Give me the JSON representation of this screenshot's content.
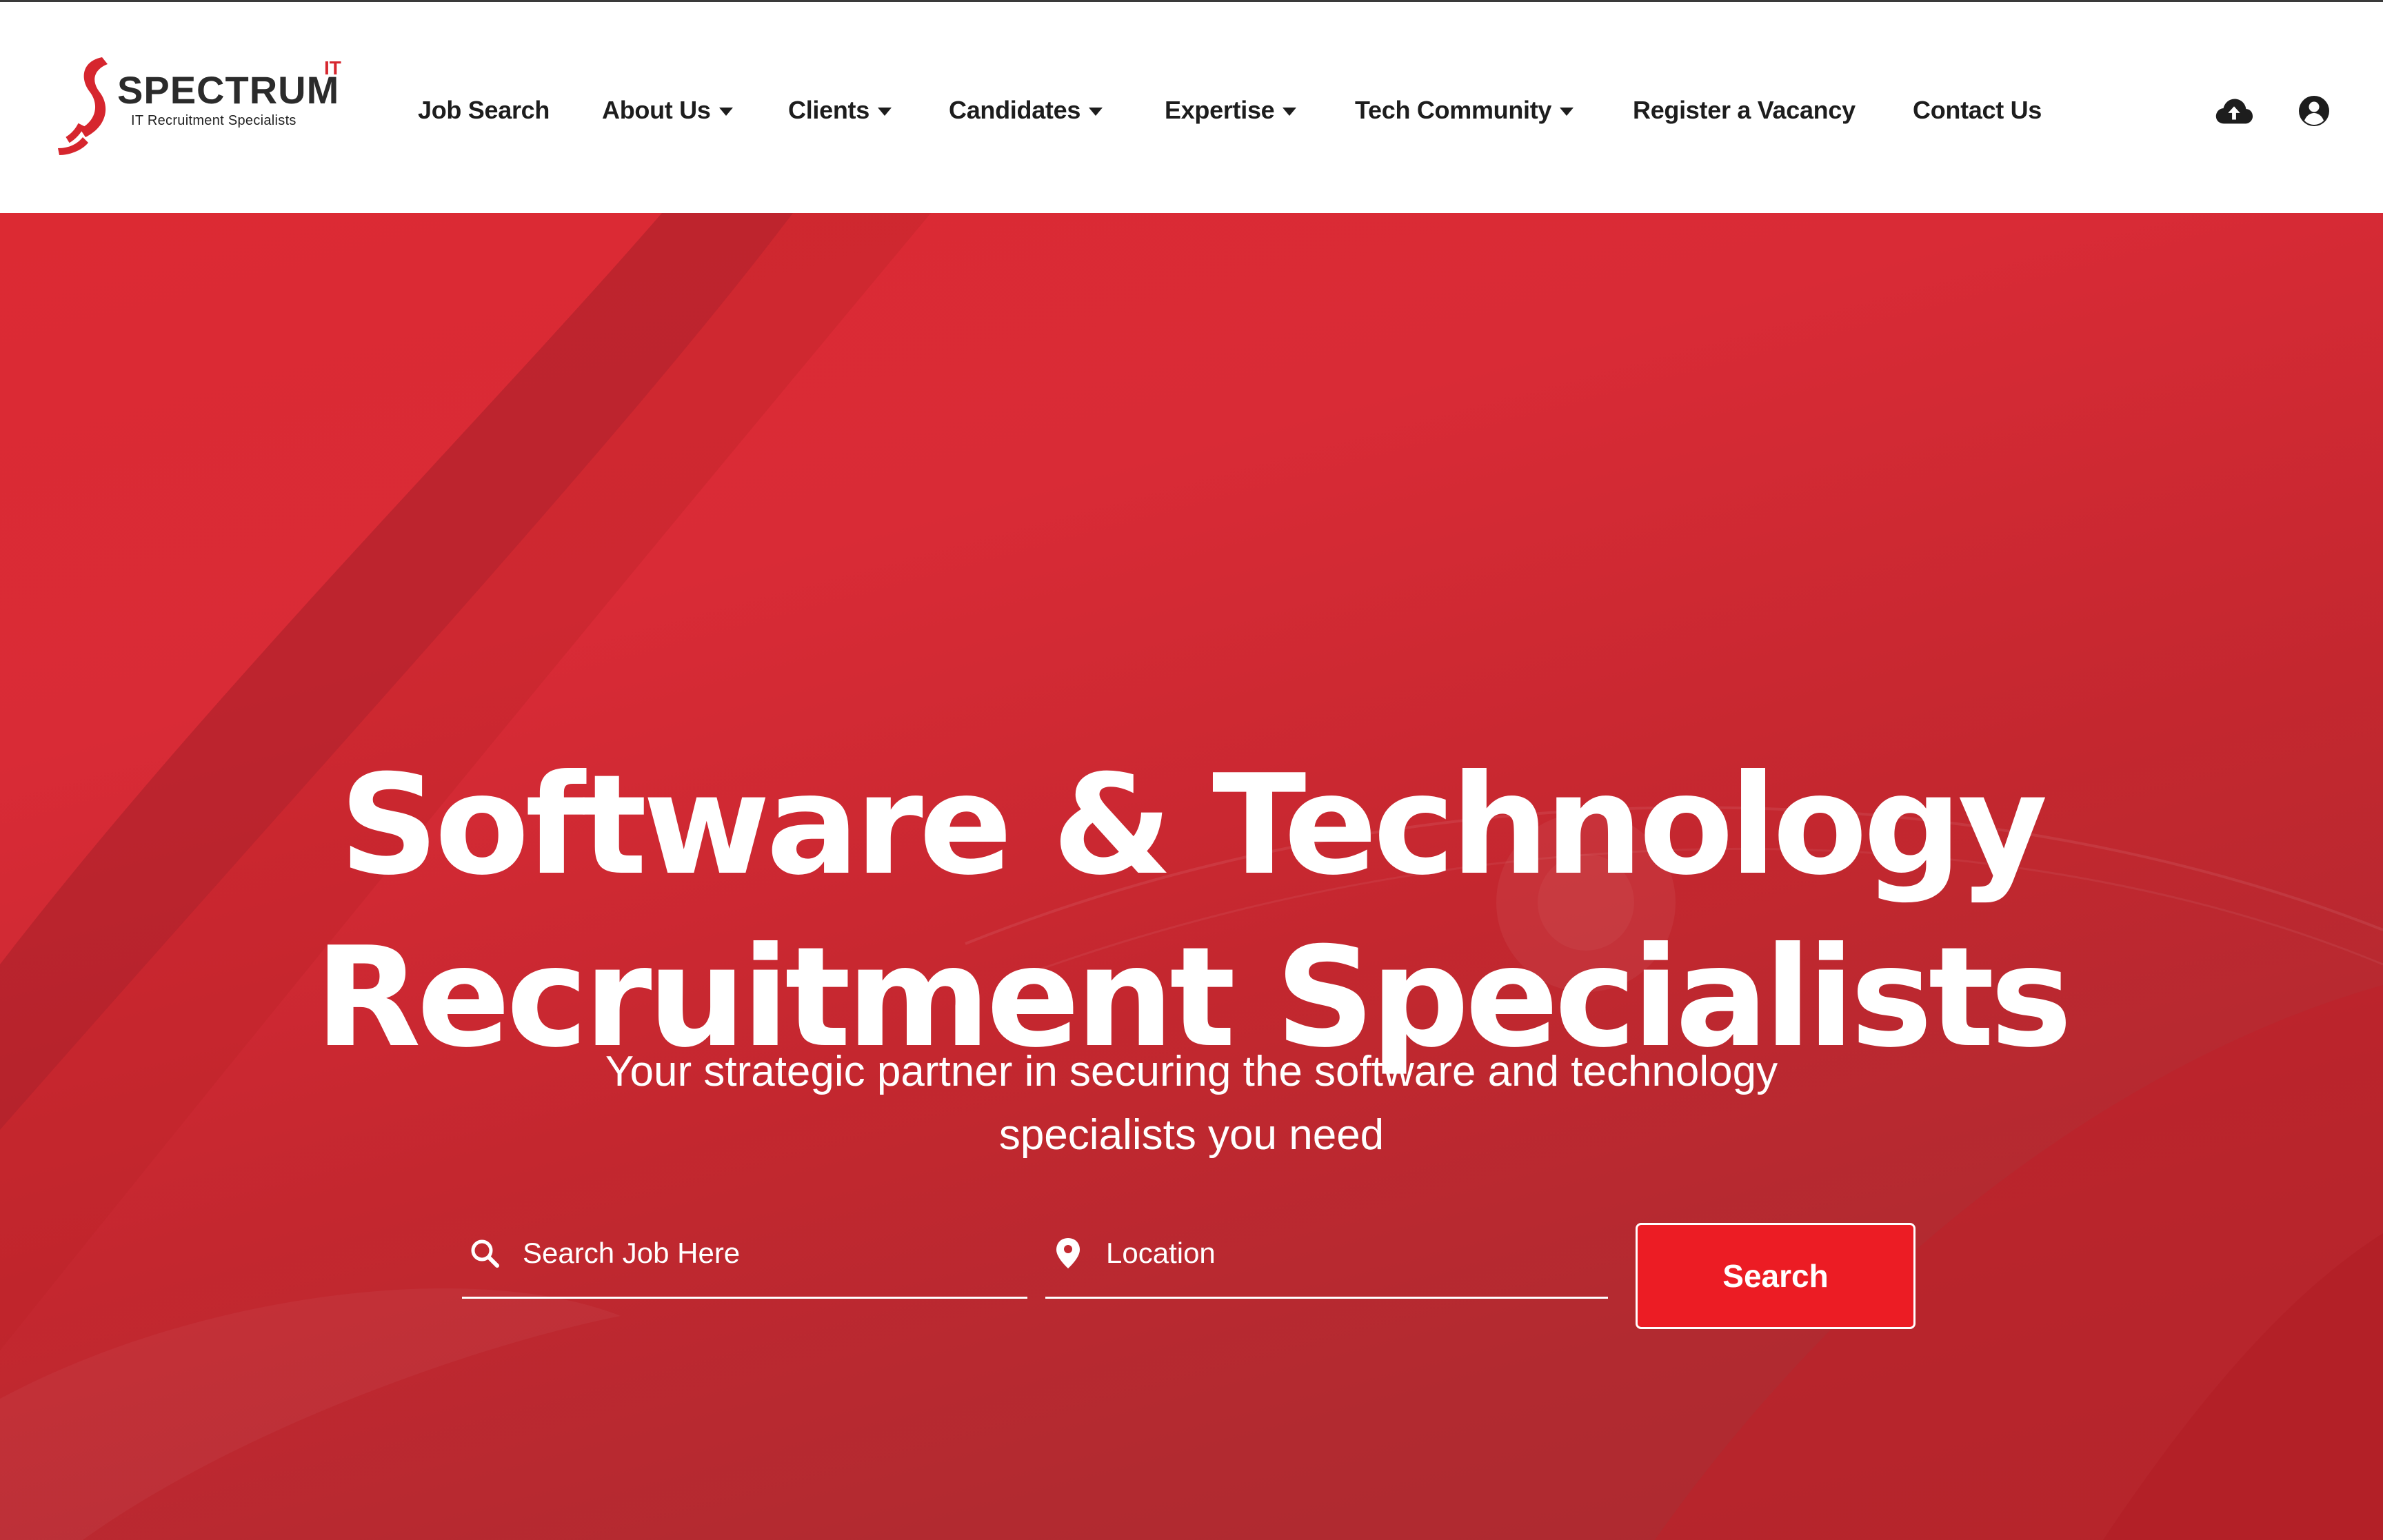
{
  "brand": {
    "name": "SPECTRUM",
    "superscript": "IT",
    "tagline": "IT Recruitment Specialists",
    "primary_color": "#d6262e"
  },
  "nav": {
    "items": [
      {
        "label": "Job Search",
        "has_dropdown": false
      },
      {
        "label": "About Us",
        "has_dropdown": true
      },
      {
        "label": "Clients",
        "has_dropdown": true
      },
      {
        "label": "Candidates",
        "has_dropdown": true
      },
      {
        "label": "Expertise",
        "has_dropdown": true
      },
      {
        "label": "Tech Community",
        "has_dropdown": true
      },
      {
        "label": "Register a Vacancy",
        "has_dropdown": false
      },
      {
        "label": "Contact Us",
        "has_dropdown": false
      }
    ],
    "icons": [
      "cloud-upload-icon",
      "user-account-icon"
    ]
  },
  "hero": {
    "title_line1": "Software & Technology",
    "title_line2": "Recruitment Specialists",
    "subtitle_line1": "Your strategic partner in securing the software and technology",
    "subtitle_line2": "specialists you need",
    "background_color": "#c8272f"
  },
  "search": {
    "job_placeholder": "Search Job Here",
    "location_placeholder": "Location",
    "button_label": "Search",
    "button_color": "#ec1c24"
  }
}
